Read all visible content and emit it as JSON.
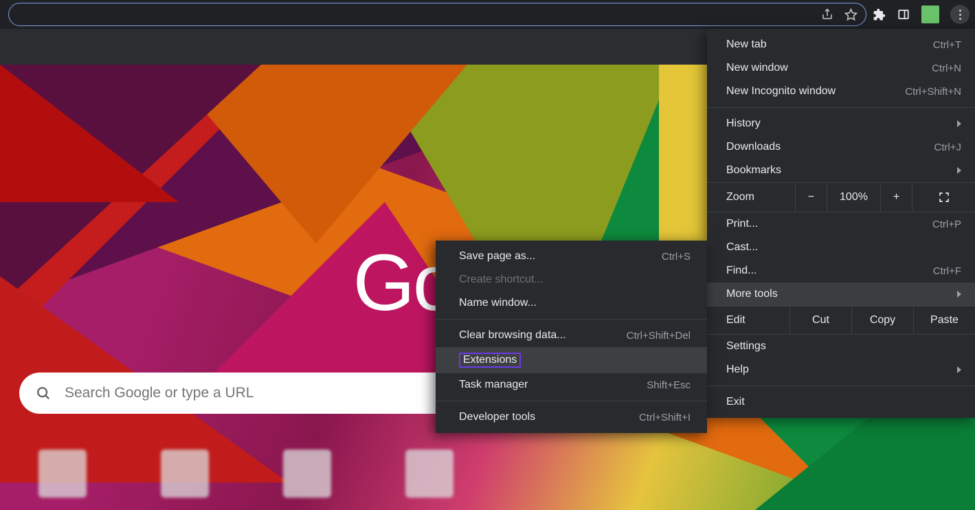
{
  "search": {
    "placeholder": "Search Google or type a URL"
  },
  "logo": "Google",
  "zoom": {
    "label": "Zoom",
    "value": "100%",
    "minus": "−",
    "plus": "+"
  },
  "edit": {
    "label": "Edit",
    "cut": "Cut",
    "copy": "Copy",
    "paste": "Paste"
  },
  "menu": {
    "new_tab": {
      "label": "New tab",
      "shortcut": "Ctrl+T"
    },
    "new_window": {
      "label": "New window",
      "shortcut": "Ctrl+N"
    },
    "new_incognito": {
      "label": "New Incognito window",
      "shortcut": "Ctrl+Shift+N"
    },
    "history": {
      "label": "History"
    },
    "downloads": {
      "label": "Downloads",
      "shortcut": "Ctrl+J"
    },
    "bookmarks": {
      "label": "Bookmarks"
    },
    "print": {
      "label": "Print...",
      "shortcut": "Ctrl+P"
    },
    "cast": {
      "label": "Cast..."
    },
    "find": {
      "label": "Find...",
      "shortcut": "Ctrl+F"
    },
    "more_tools": {
      "label": "More tools"
    },
    "settings": {
      "label": "Settings"
    },
    "help": {
      "label": "Help"
    },
    "exit": {
      "label": "Exit"
    }
  },
  "submenu": {
    "save_page": {
      "label": "Save page as...",
      "shortcut": "Ctrl+S"
    },
    "create_shortcut": {
      "label": "Create shortcut..."
    },
    "name_window": {
      "label": "Name window..."
    },
    "clear_browsing": {
      "label": "Clear browsing data...",
      "shortcut": "Ctrl+Shift+Del"
    },
    "extensions": {
      "label": "Extensions"
    },
    "task_manager": {
      "label": "Task manager",
      "shortcut": "Shift+Esc"
    },
    "developer_tools": {
      "label": "Developer tools",
      "shortcut": "Ctrl+Shift+I"
    }
  }
}
